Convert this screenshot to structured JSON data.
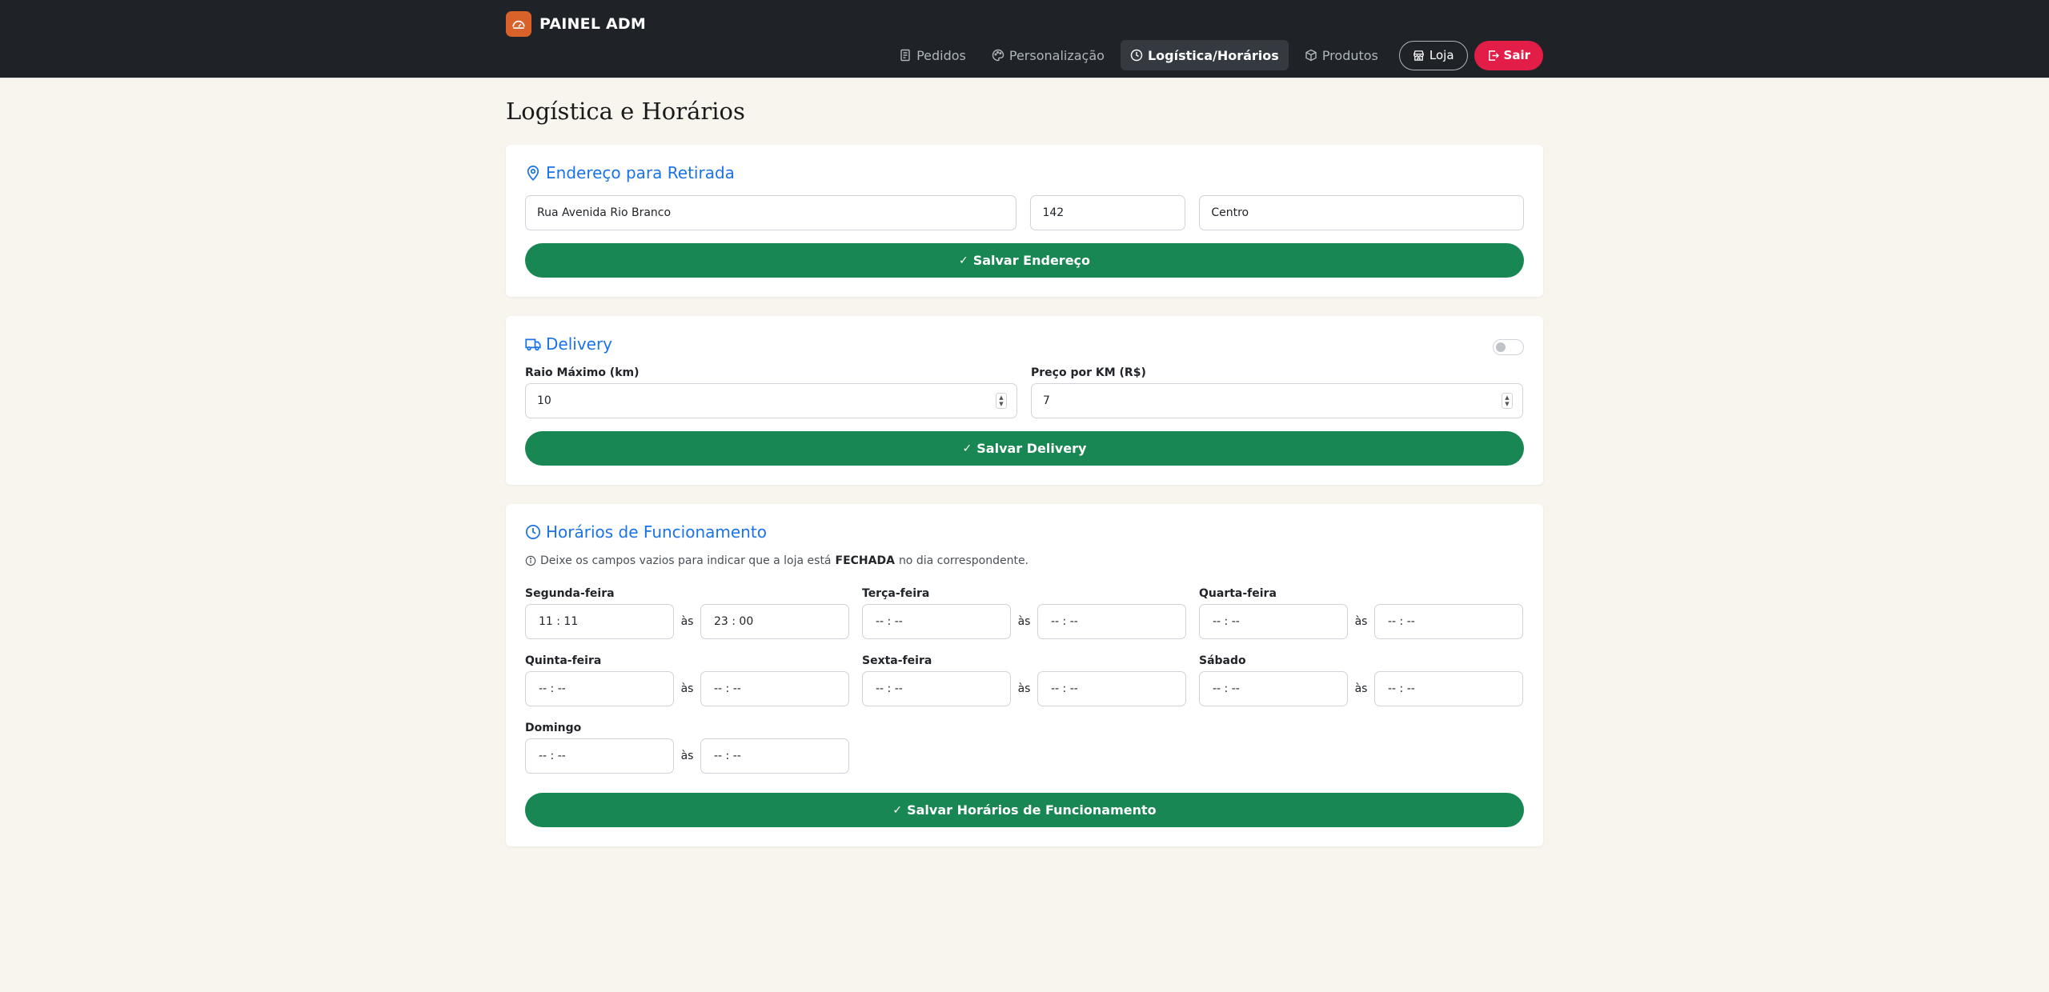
{
  "brand": {
    "title": "PAINEL ADM"
  },
  "nav": {
    "items": [
      {
        "label": "Pedidos",
        "icon": "receipt-icon"
      },
      {
        "label": "Personalização",
        "icon": "palette-icon"
      },
      {
        "label": "Logística/Horários",
        "icon": "clock-icon",
        "active": true
      },
      {
        "label": "Produtos",
        "icon": "box-icon"
      }
    ],
    "loja_label": "Loja",
    "sair_label": "Sair"
  },
  "page": {
    "title": "Logística e Horários"
  },
  "address": {
    "title": "Endereço para Retirada",
    "street": "Rua Avenida Rio Branco",
    "number": "142",
    "district": "Centro",
    "save_label": "Salvar Endereço"
  },
  "delivery": {
    "title": "Delivery",
    "enabled": false,
    "radius_label": "Raio Máximo (km)",
    "radius_value": "10",
    "price_label": "Preço por KM (R$)",
    "price_value": "7",
    "save_label": "Salvar Delivery"
  },
  "hours": {
    "title": "Horários de Funcionamento",
    "hint_before": "Deixe os campos vazios para indicar que a loja está",
    "hint_bold": "FECHADA",
    "hint_after": "no dia correspondente.",
    "separator": "às",
    "days": [
      {
        "name": "Segunda-feira",
        "open": "11 : 11",
        "close": "23 : 00"
      },
      {
        "name": "Terça-feira",
        "open": "-- : --",
        "close": "-- : --"
      },
      {
        "name": "Quarta-feira",
        "open": "-- : --",
        "close": "-- : --"
      },
      {
        "name": "Quinta-feira",
        "open": "-- : --",
        "close": "-- : --"
      },
      {
        "name": "Sexta-feira",
        "open": "-- : --",
        "close": "-- : --"
      },
      {
        "name": "Sábado",
        "open": "-- : --",
        "close": "-- : --"
      },
      {
        "name": "Domingo",
        "open": "-- : --",
        "close": "-- : --"
      }
    ],
    "save_label": "Salvar Horários de Funcionamento"
  },
  "colors": {
    "navbar": "#1f2328",
    "accent_blue": "#1a73e8",
    "save_green": "#198754",
    "exit_red": "#e11d48",
    "brand_orange": "#d9622b"
  }
}
